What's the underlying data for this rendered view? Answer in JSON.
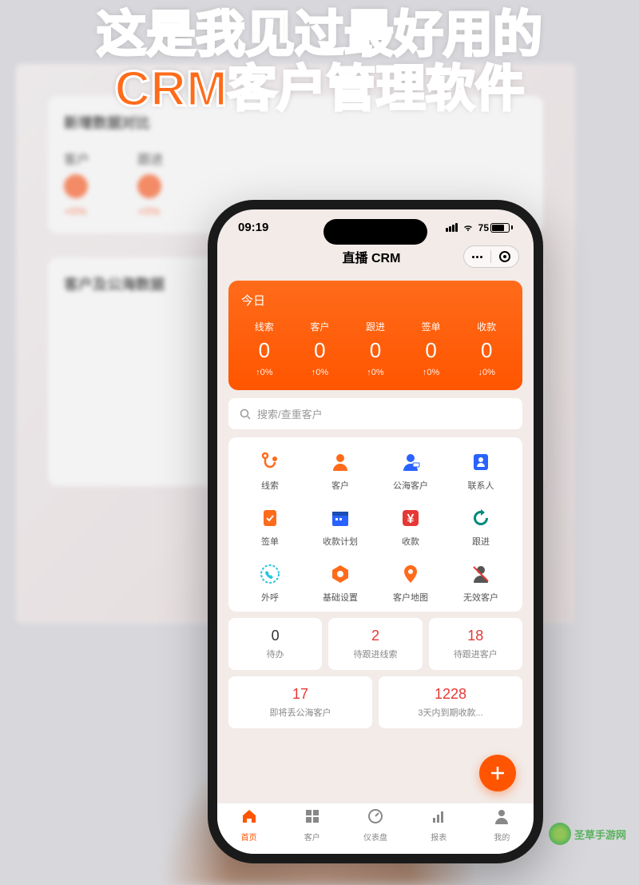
{
  "headline": {
    "line1": "这是我见过最好用的",
    "line2": "CRM客户管理软件"
  },
  "bg": {
    "section1_title": "新增数据对比",
    "stat1_label": "客户",
    "stat1_pct": "+0%",
    "stat2_label": "跟进",
    "stat2_pct": "+0%",
    "section2_title": "客户及公海数据"
  },
  "status": {
    "time": "09:19",
    "battery": "75"
  },
  "app": {
    "title": "直播 CRM"
  },
  "today": {
    "label": "今日",
    "stats": [
      {
        "label": "线索",
        "value": "0",
        "delta": "↑0%"
      },
      {
        "label": "客户",
        "value": "0",
        "delta": "↑0%"
      },
      {
        "label": "跟进",
        "value": "0",
        "delta": "↑0%"
      },
      {
        "label": "签单",
        "value": "0",
        "delta": "↑0%"
      },
      {
        "label": "收款",
        "value": "0",
        "delta": "↓0%"
      }
    ]
  },
  "search": {
    "placeholder": "搜索/查重客户"
  },
  "grid": [
    {
      "label": "线索",
      "icon": "stethoscope-icon",
      "color": "#ff6b1a"
    },
    {
      "label": "客户",
      "icon": "person-icon",
      "color": "#ff6b1a"
    },
    {
      "label": "公海客户",
      "icon": "person-public-icon",
      "color": "#2962ff"
    },
    {
      "label": "联系人",
      "icon": "contact-icon",
      "color": "#2962ff"
    },
    {
      "label": "签单",
      "icon": "clipboard-check-icon",
      "color": "#ff6b1a"
    },
    {
      "label": "收款计划",
      "icon": "calendar-icon",
      "color": "#2962ff"
    },
    {
      "label": "收款",
      "icon": "yen-icon",
      "color": "#e53935"
    },
    {
      "label": "跟进",
      "icon": "refresh-icon",
      "color": "#00897b"
    },
    {
      "label": "外呼",
      "icon": "phone-out-icon",
      "color": "#26c6da"
    },
    {
      "label": "基础设置",
      "icon": "gear-hex-icon",
      "color": "#ff6b1a"
    },
    {
      "label": "客户地图",
      "icon": "pin-icon",
      "color": "#ff6b1a"
    },
    {
      "label": "无效客户",
      "icon": "person-void-icon",
      "color": "#555"
    }
  ],
  "tiles": [
    {
      "num": "0",
      "label": "待办",
      "red": false
    },
    {
      "num": "2",
      "label": "待跟进线索",
      "red": true
    },
    {
      "num": "18",
      "label": "待跟进客户",
      "red": true
    },
    {
      "num": "17",
      "label": "即将丢公海客户",
      "red": true
    },
    {
      "num": "1228",
      "label": "3天内到期收款...",
      "red": true
    }
  ],
  "tabs": [
    {
      "label": "首页",
      "icon": "home-icon",
      "active": true
    },
    {
      "label": "客户",
      "icon": "grid-icon",
      "active": false
    },
    {
      "label": "仪表盘",
      "icon": "dashboard-icon",
      "active": false
    },
    {
      "label": "报表",
      "icon": "report-icon",
      "active": false
    },
    {
      "label": "我的",
      "icon": "user-icon",
      "active": false
    }
  ],
  "watermark": {
    "text": "圣草手游网"
  }
}
